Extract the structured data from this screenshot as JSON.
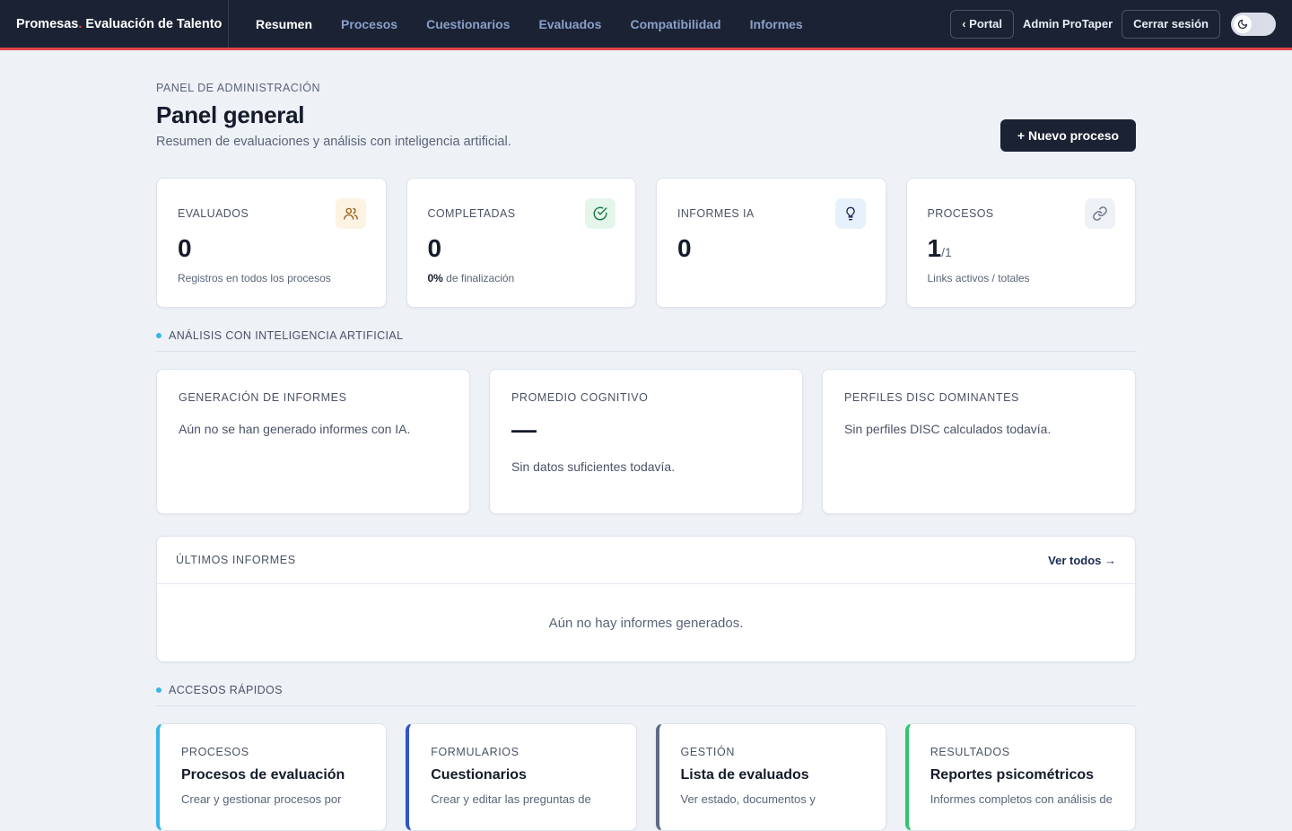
{
  "brand": {
    "name": "Promesas",
    "dot": ".",
    "product": " Evaluación de Talento"
  },
  "nav": {
    "resumen": "Resumen",
    "procesos": "Procesos",
    "cuestionarios": "Cuestionarios",
    "evaluados": "Evaluados",
    "compatibilidad": "Compatibilidad",
    "informes": "Informes",
    "active": "Resumen"
  },
  "topright": {
    "portal": "‹ Portal",
    "user": "Admin ProTaper",
    "logout": "Cerrar sesión",
    "theme_icon": "moon-icon"
  },
  "header": {
    "eyebrow": "PANEL DE ADMINISTRACIÓN",
    "title": "Panel general",
    "subtitle": "Resumen de evaluaciones y análisis con inteligencia artificial.",
    "new_process": "+ Nuevo proceso"
  },
  "stats": {
    "evaluados": {
      "label": "EVALUADOS",
      "value": "0",
      "note": "Registros en todos los procesos",
      "icon": "users-icon"
    },
    "completadas": {
      "label": "COMPLETADAS",
      "value": "0",
      "note_strong": "0%",
      "note": " de finalización",
      "icon": "check-circle-icon"
    },
    "informes": {
      "label": "INFORMES IA",
      "value": "0",
      "icon": "lightbulb-icon"
    },
    "procesos": {
      "label": "PROCESOS",
      "value": "1",
      "total": "/1",
      "note": "Links activos / totales",
      "icon": "link-icon"
    }
  },
  "ai_section": {
    "title": "ANÁLISIS CON INTELIGENCIA ARTIFICIAL",
    "generation": {
      "label": "GENERACIÓN DE INFORMES",
      "text": "Aún no se han generado informes con IA."
    },
    "cognitive": {
      "label": "PROMEDIO COGNITIVO",
      "value": "—",
      "text": "Sin datos suficientes todavía."
    },
    "disc": {
      "label": "PERFILES DISC DOMINANTES",
      "text": "Sin perfiles DISC calculados todavía."
    }
  },
  "latest_reports": {
    "label": "ÚLTIMOS INFORMES",
    "view_all": "Ver todos →",
    "empty": "Aún no hay informes generados."
  },
  "quick_access": {
    "title": "ACCESOS RÁPIDOS",
    "cards": [
      {
        "label": "PROCESOS",
        "title": "Procesos de evaluación",
        "desc": "Crear y gestionar procesos por",
        "color": "#38b6e8"
      },
      {
        "label": "FORMULARIOS",
        "title": "Cuestionarios",
        "desc": "Crear y editar las preguntas de",
        "color": "#2f55c9"
      },
      {
        "label": "GESTIÓN",
        "title": "Lista de evaluados",
        "desc": "Ver estado, documentos y",
        "color": "#5d6b86"
      },
      {
        "label": "RESULTADOS",
        "title": "Reportes psicométricos",
        "desc": "Informes completos con análisis de",
        "color": "#2dc76d"
      }
    ]
  },
  "colors": {
    "topbar": "#1b2233",
    "accent_red": "#e2454b",
    "nav_inactive": "#8aa0c9",
    "bullet": "#38b6e8"
  }
}
